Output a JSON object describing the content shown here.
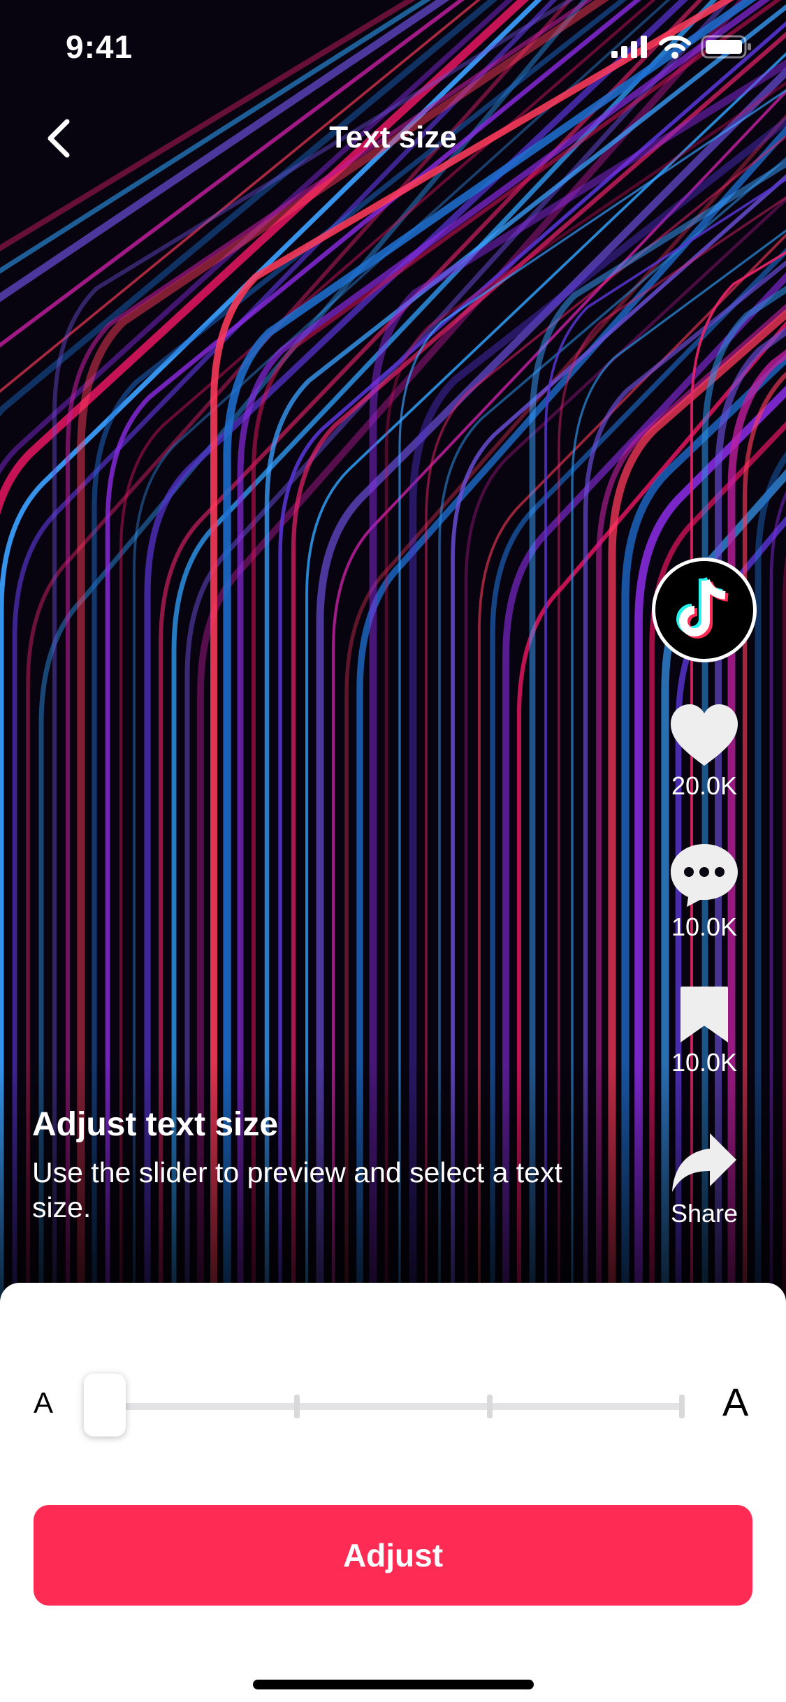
{
  "status_bar": {
    "time": "9:41"
  },
  "nav": {
    "title": "Text size"
  },
  "rail": {
    "likes": "20.0K",
    "comments": "10.0K",
    "bookmarks": "10.0K",
    "share": "Share"
  },
  "caption": {
    "title": "Adjust text size",
    "body": "Use the slider to preview and select a text size."
  },
  "sheet": {
    "small_a": "A",
    "large_a": "A",
    "slider": {
      "steps": 4,
      "selected_index": 0
    },
    "button_label": "Adjust"
  },
  "colors": {
    "accent": "#fe2c55",
    "sheet_bg": "#ffffff",
    "track": "#e3e3e6"
  }
}
